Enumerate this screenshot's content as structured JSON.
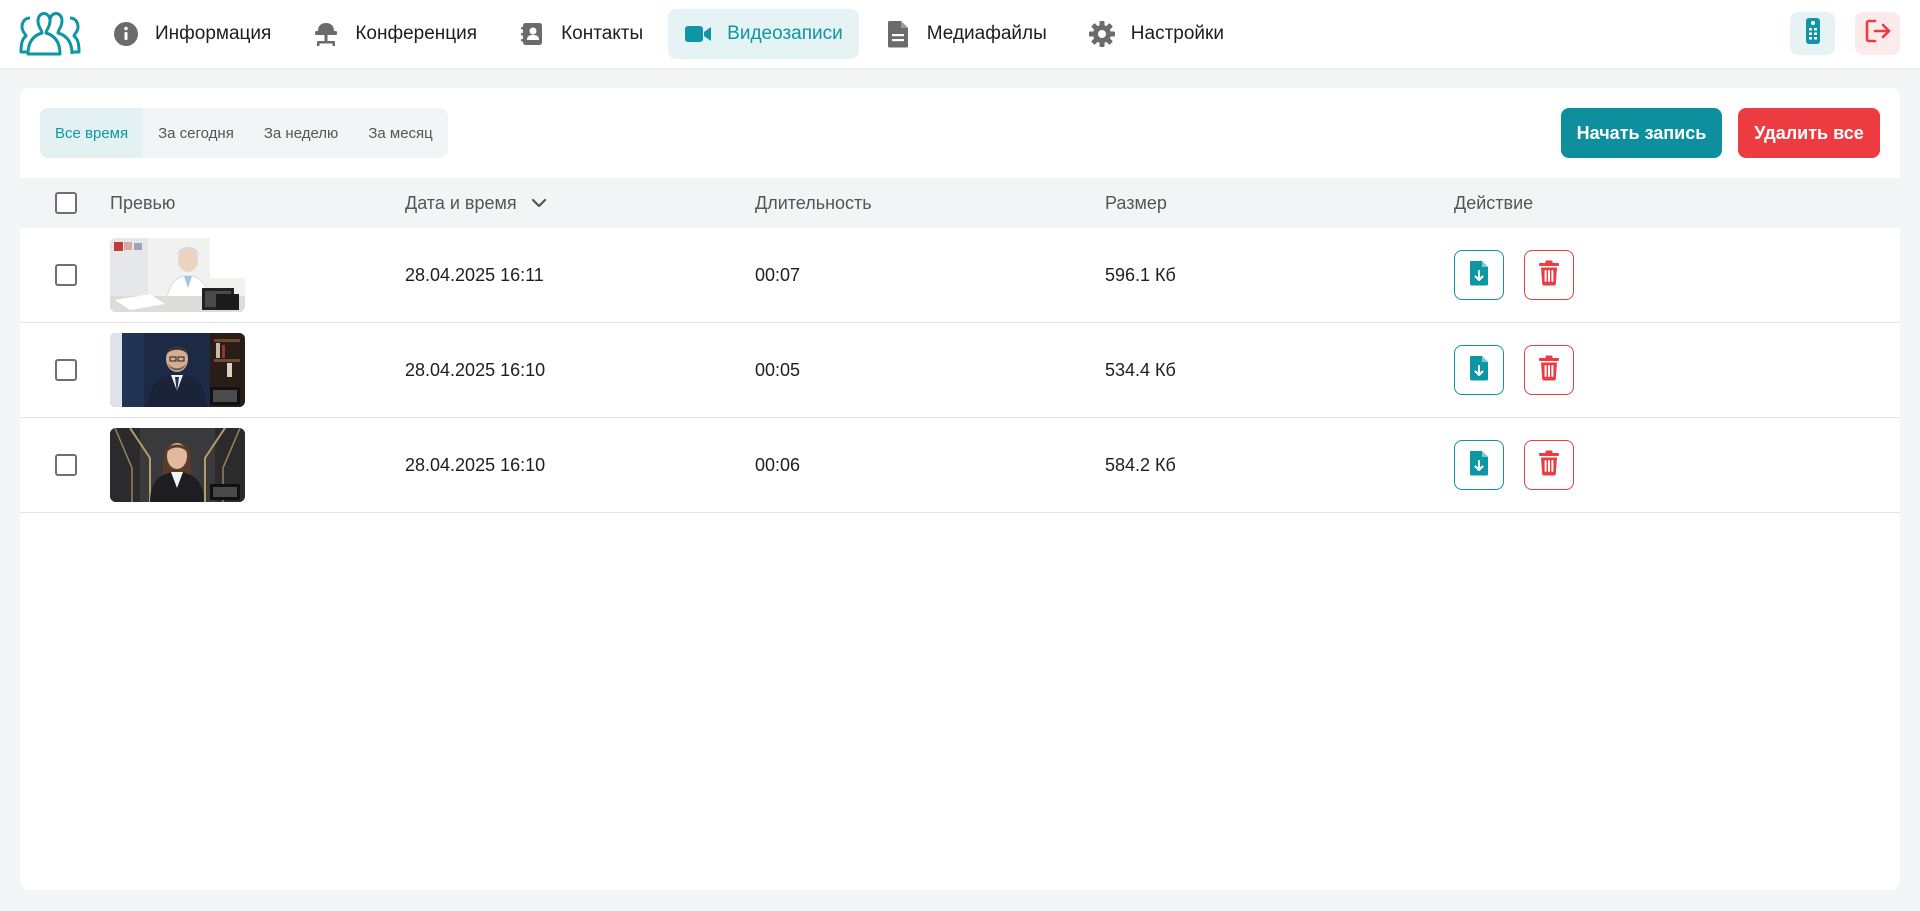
{
  "colors": {
    "accent": "#0e96a4",
    "danger": "#ec3b41",
    "background": "#f4f5f7"
  },
  "nav": {
    "items": [
      {
        "label": "Информация",
        "icon": "info-icon",
        "active": false
      },
      {
        "label": "Конференция",
        "icon": "conference-icon",
        "active": false
      },
      {
        "label": "Контакты",
        "icon": "contacts-icon",
        "active": false
      },
      {
        "label": "Видеозаписи",
        "icon": "video-icon",
        "active": true
      },
      {
        "label": "Медиафайлы",
        "icon": "file-icon",
        "active": false
      },
      {
        "label": "Настройки",
        "icon": "gear-icon",
        "active": false
      }
    ],
    "right_icons": [
      "remote-control-icon",
      "logout-icon"
    ]
  },
  "filters": {
    "tabs": [
      {
        "label": "Все время",
        "active": true
      },
      {
        "label": "За сегодня",
        "active": false
      },
      {
        "label": "За неделю",
        "active": false
      },
      {
        "label": "За месяц",
        "active": false
      }
    ]
  },
  "actions": {
    "start_label": "Начать запись",
    "delete_all_label": "Удалить все"
  },
  "table": {
    "columns": {
      "preview": "Превью",
      "datetime": "Дата и время",
      "duration": "Длительность",
      "size": "Размер",
      "action": "Действие"
    },
    "sort": {
      "column": "datetime",
      "direction": "desc",
      "icon": "chevron-down-icon"
    },
    "rows": [
      {
        "datetime": "28.04.2025 16:11",
        "duration": "00:07",
        "size": "596.1 Кб",
        "preview": "woman-doctor-office-thumbnail",
        "checked": false
      },
      {
        "datetime": "28.04.2025 16:10",
        "duration": "00:05",
        "size": "534.4 Кб",
        "preview": "man-in-suit-thumbnail",
        "checked": false
      },
      {
        "datetime": "28.04.2025 16:10",
        "duration": "00:06",
        "size": "584.2 Кб",
        "preview": "woman-presenter-thumbnail",
        "checked": false
      }
    ]
  }
}
